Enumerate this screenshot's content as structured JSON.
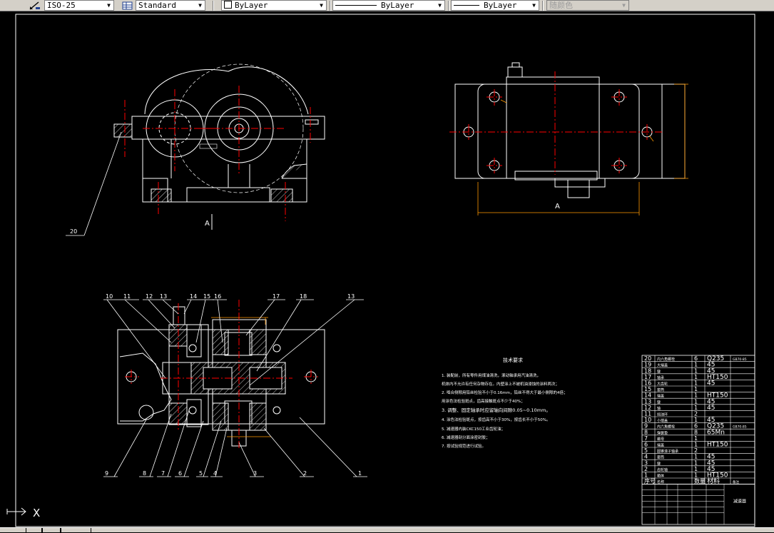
{
  "toolbar": {
    "dimstyle_value": "ISO-25",
    "tablestyle_value": "Standard",
    "color_value": "ByLayer",
    "linetype_value": "ByLayer",
    "lineweight_value": "ByLayer",
    "plotstyle_value": "随颜色"
  },
  "drawing": {
    "section_label_top": "A",
    "section_label_right": "A",
    "balloons": {
      "b20": "20",
      "b10": "10",
      "b11": "11",
      "b12": "12",
      "b13a": "13",
      "b14": "14",
      "b15": "15",
      "b16": "16",
      "b17": "17",
      "b18": "18",
      "b13b": "13",
      "b9": "9",
      "b8": "8",
      "b7": "7",
      "b6": "6",
      "b5": "5",
      "b4": "4",
      "b3": "3",
      "b2": "2",
      "b1": "1"
    },
    "tech_title": "技术要求",
    "tech_items": [
      "1. 装配前，所有零件用煤油清洗，滚动轴承用汽油清洗，",
      "   机体内不允许有任何杂物存在。内壁涂上不被机油浸蚀的涂料两次；",
      "2. 啮合侧隙用铅丝检验不小于0.16mm，铅丝不得大于最小侧隙的4倍；",
      "   用涂色法检验斑点，齿高接触斑点不少于40%；",
      "3. 调整、固定轴承时应留轴向间隙0.05~0.10mm。",
      "4. 涂色法检验斑点，按齿高不小于30%，按齿长不小于50%。",
      "5. 减速器内装CKC150工业齿轮油；",
      "6. 减速器剖分面涂密封胶；",
      "7. 按试验规范进行试验。"
    ]
  },
  "bom": {
    "rows": [
      {
        "no": "20",
        "name": "内六角螺栓",
        "qty": "6",
        "mat": "Q235",
        "note": "GB70-85"
      },
      {
        "no": "19",
        "name": "大端盖",
        "qty": "1",
        "mat": "45",
        "note": ""
      },
      {
        "no": "18",
        "name": "键",
        "qty": "1",
        "mat": "45",
        "note": ""
      },
      {
        "no": "17",
        "name": "轴承",
        "qty": "1",
        "mat": "HT150",
        "note": ""
      },
      {
        "no": "16",
        "name": "大齿轮",
        "qty": "1",
        "mat": "45",
        "note": ""
      },
      {
        "no": "15",
        "name": "套筒",
        "qty": "1",
        "mat": "",
        "note": ""
      },
      {
        "no": "14",
        "name": "端盖",
        "qty": "1",
        "mat": "HT150",
        "note": ""
      },
      {
        "no": "13",
        "name": "键",
        "qty": "1",
        "mat": "45",
        "note": ""
      },
      {
        "no": "12",
        "name": "轴",
        "qty": "1",
        "mat": "45",
        "note": ""
      },
      {
        "no": "11",
        "name": "挡油环",
        "qty": "2",
        "mat": "",
        "note": ""
      },
      {
        "no": "10",
        "name": "小端盖",
        "qty": "1",
        "mat": "45",
        "note": ""
      },
      {
        "no": "9",
        "name": "内六角螺栓",
        "qty": "6",
        "mat": "Q235",
        "note": "GB70-85"
      },
      {
        "no": "8",
        "name": "弹簧垫",
        "qty": "8",
        "mat": "65Mn",
        "note": ""
      },
      {
        "no": "7",
        "name": "螺母",
        "qty": "1",
        "mat": "",
        "note": ""
      },
      {
        "no": "6",
        "name": "端盖",
        "qty": "1",
        "mat": "HT150",
        "note": ""
      },
      {
        "no": "5",
        "name": "圆锥滚子轴承",
        "qty": "2",
        "mat": "",
        "note": ""
      },
      {
        "no": "4",
        "name": "套筒",
        "qty": "1",
        "mat": "45",
        "note": ""
      },
      {
        "no": "3",
        "name": "键",
        "qty": "1",
        "mat": "45",
        "note": ""
      },
      {
        "no": "2",
        "name": "齿轮轴",
        "qty": "1",
        "mat": "45",
        "note": ""
      },
      {
        "no": "1",
        "name": "箱体",
        "qty": "1",
        "mat": "HT150",
        "note": ""
      }
    ],
    "header": {
      "no": "序号",
      "name": "名称",
      "qty": "数量",
      "mat": "材料",
      "note": "备注"
    },
    "title_block_name": "减速器"
  },
  "colors": {
    "line": "#ffffff",
    "center": "#ff0000",
    "dimension": "#ff9900",
    "hatch": "#ffffff",
    "background": "#000000"
  },
  "ucs": {
    "x_label": "X"
  }
}
